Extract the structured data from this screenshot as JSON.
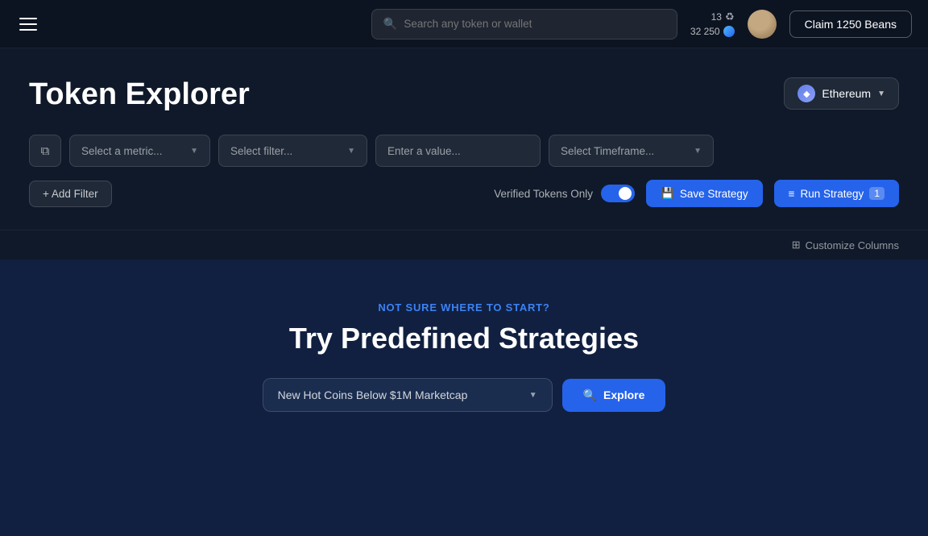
{
  "topnav": {
    "search_placeholder": "Search any token or wallet",
    "stats": {
      "count": "13",
      "beans": "32 250"
    },
    "claim_label": "Claim 1250 Beans"
  },
  "page": {
    "title": "Token Explorer",
    "network": "Ethereum"
  },
  "filters": {
    "metric_placeholder": "Select a metric...",
    "filter_placeholder": "Select filter...",
    "value_placeholder": "Enter a value...",
    "timeframe_placeholder": "Select Timeframe..."
  },
  "actions": {
    "add_filter_label": "+ Add Filter",
    "verified_toggle_label": "Verified Tokens Only",
    "save_strategy_label": "Save Strategy",
    "run_strategy_label": "Run Strategy",
    "run_strategy_count": "1",
    "customize_columns_label": "Customize Columns"
  },
  "predefined": {
    "eyebrow": "NOT SURE WHERE TO START?",
    "title": "Try Predefined Strategies",
    "dropdown_value": "New Hot Coins Below $1M Marketcap",
    "explore_label": "Explore"
  }
}
